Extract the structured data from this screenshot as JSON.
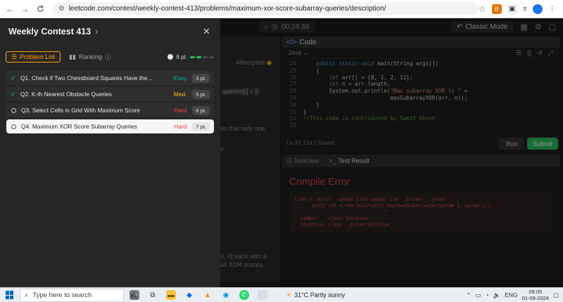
{
  "browser": {
    "url": "leetcode.com/contest/weekly-contest-413/problems/maximum-xor-score-subarray-queries/description/",
    "back_icon": "←",
    "forward_icon": "→",
    "reload_icon": "C"
  },
  "topbar": {
    "timer": "00:24:39",
    "classic_mode": "Classic Mode"
  },
  "description": {
    "attempted": "Attempted",
    "snippet": "queries[i] = [l",
    "line1": "so that only one",
    "line2": "e.",
    "line3": "0, 4] each with a",
    "line4": "all XOR scores."
  },
  "code": {
    "header": "Code",
    "language": "Java",
    "lines": [
      {
        "n": "24",
        "html": "    <span class='kw'>public static void</span> main(String args[])"
      },
      {
        "n": "25",
        "html": "    {"
      },
      {
        "n": "26",
        "html": "        <span class='kw'>int</span> arr[] = {8, 1, 2, 12};"
      },
      {
        "n": "27",
        "html": "        <span class='kw'>int</span> n = arr.length;"
      },
      {
        "n": "28",
        "html": "        System.out.println(<span class='str'>\"Max subarray XOR is \"</span> +"
      },
      {
        "n": "29",
        "html": "                           maxSubarrayXOR(arr, n));"
      },
      {
        "n": "30",
        "html": "    }"
      },
      {
        "n": "31",
        "html": "}"
      },
      {
        "n": "32",
        "html": "<span class='cm'>//This code is contributed by Sumit Ghosh</span>"
      },
      {
        "n": "33",
        "html": ""
      }
    ],
    "footer": "Ln 33, Col 1    Saved",
    "run": "Run",
    "submit": "Submit"
  },
  "test": {
    "tab_testcase": "Testcase",
    "tab_result": "Test Result",
    "compile_title": "Compile Error",
    "error_text": "Line 7: error: cannot find symbol [in __Driver__.java]\n      int[] ret = new Solution().maximumSubarrayXor(param_1, param_2);\n                                ^\n  symbol:   class Solution\n  location: class __DriverSolution__"
  },
  "drawer": {
    "title": "Weekly Contest 413",
    "tab_problem_list": "Problem List",
    "tab_ranking": "Ranking",
    "points": "8 pt.",
    "points_progress": 0.5,
    "problems": [
      {
        "name": "Q1. Check if Two Chessboard Squares Have the...",
        "difficulty": "Easy",
        "pts": "3 pt.",
        "solved": true
      },
      {
        "name": "Q2. K-th Nearest Obstacle Queries",
        "difficulty": "Med.",
        "pts": "5 pt.",
        "solved": true
      },
      {
        "name": "Q3. Select Cells in Grid With Maximum Score",
        "difficulty": "Hard",
        "pts": "6 pt.",
        "solved": false
      },
      {
        "name": "Q4. Maximum XOR Score Subarray Queries",
        "difficulty": "Hard",
        "pts": "7 pt.",
        "solved": false
      }
    ]
  },
  "taskbar": {
    "search_placeholder": "Type here to search",
    "weather": "31°C  Partly sunny",
    "lang": "ENG",
    "time": "09:05",
    "date": "01-09-2024"
  },
  "colors": {
    "accent": "#ffa116",
    "easy": "#00b8a3",
    "medium": "#ffc01e",
    "hard": "#ef4743",
    "submit": "#2cbb5d"
  }
}
